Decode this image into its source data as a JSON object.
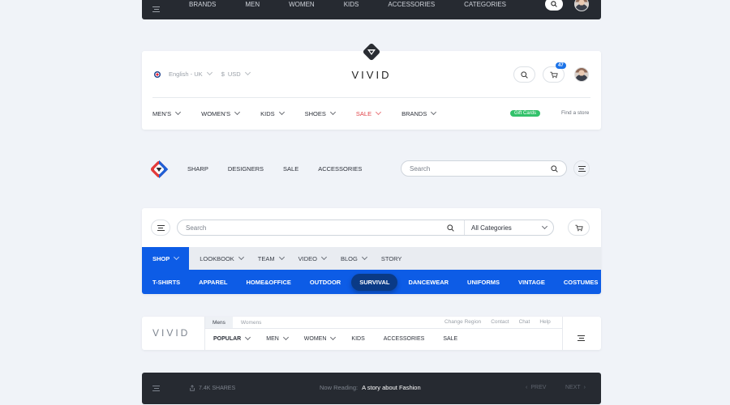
{
  "bar1": {
    "nav": [
      "BRANDS",
      "MEN",
      "WOMEN",
      "KIDS",
      "ACCESSORIES",
      "CATEGORIES"
    ]
  },
  "card2": {
    "language": "English - UK",
    "currency": "USD",
    "logo": "VIVID",
    "cart_count": "47",
    "nav": [
      "MEN'S",
      "WOMEN'S",
      "KIDS",
      "SHOES",
      "SALE",
      "BRANDS"
    ],
    "gift_cards": "Gift Cards",
    "find_store": "Find a store",
    "colors": {
      "sale": "#e0454a",
      "gift": "#33c26b"
    }
  },
  "bar3": {
    "nav": [
      "SHARP",
      "DESIGNERS",
      "SALE",
      "ACCESSORIES"
    ],
    "search_placeholder": "Search"
  },
  "card4": {
    "search_placeholder": "Search",
    "category_select": "All Categories",
    "main_nav": [
      {
        "label": "SHOP",
        "active": true,
        "dropdown": true
      },
      {
        "label": "LOOKBOOK",
        "dropdown": true
      },
      {
        "label": "TEAM",
        "dropdown": true
      },
      {
        "label": "VIDEO",
        "dropdown": true
      },
      {
        "label": "BLOG",
        "dropdown": true
      },
      {
        "label": "STORY",
        "dropdown": false
      }
    ],
    "categories": [
      "T-SHIRTS",
      "APPAREL",
      "HOME&OFFICE",
      "OUTDOOR",
      "SURVIVAL",
      "DANCEWEAR",
      "UNIFORMS",
      "VINTAGE",
      "COSTUMES"
    ],
    "active_category": "SURVIVAL",
    "colors": {
      "primary": "#0d5ce6",
      "active_pill": "#0a3a86"
    }
  },
  "card5": {
    "logo": "VIVID",
    "tabs": [
      "Mens",
      "Womens"
    ],
    "util_links": [
      "Change Region",
      "Contact",
      "Chat",
      "Help"
    ],
    "nav": [
      {
        "label": "POPULAR",
        "dropdown": true,
        "bold": true
      },
      {
        "label": "MEN",
        "dropdown": true
      },
      {
        "label": "WOMEN",
        "dropdown": true
      },
      {
        "label": "KIDS",
        "dropdown": false
      },
      {
        "label": "ACCESSORIES",
        "dropdown": false
      },
      {
        "label": "SALE",
        "dropdown": false
      }
    ]
  },
  "bar6": {
    "shares": "7.4K SHARES",
    "now_reading_label": "Now Reading:",
    "now_reading_title": "A story about Fashion",
    "prev": "PREV",
    "next": "NEXT"
  }
}
